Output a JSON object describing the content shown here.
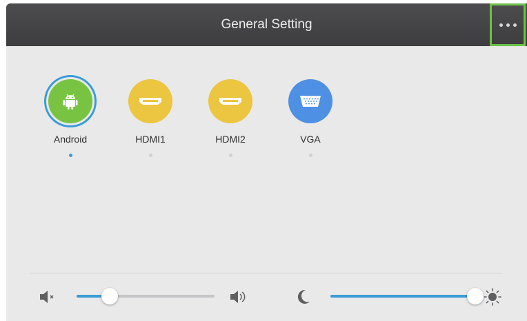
{
  "header": {
    "title": "General Setting",
    "more_icon": "more-horizontal-icon"
  },
  "colors": {
    "header_bg": "#444446",
    "panel_bg": "#e9e9ea",
    "accent": "#3a9bd9",
    "highlight_border": "#6cc24a",
    "android_green": "#78c442",
    "hdmi_yellow": "#ecc541",
    "vga_blue": "#4e90e4"
  },
  "sources": [
    {
      "label": "Android",
      "icon": "android-icon",
      "selected": true
    },
    {
      "label": "HDMI1",
      "icon": "hdmi-icon",
      "selected": false
    },
    {
      "label": "HDMI2",
      "icon": "hdmi-icon",
      "selected": false
    },
    {
      "label": "VGA",
      "icon": "vga-icon",
      "selected": false
    }
  ],
  "volume": {
    "min_icon": "volume-mute-icon",
    "max_icon": "volume-up-icon",
    "level": 0.24
  },
  "brightness": {
    "min_icon": "moon-icon",
    "max_icon": "sun-icon",
    "level": 1.0
  }
}
